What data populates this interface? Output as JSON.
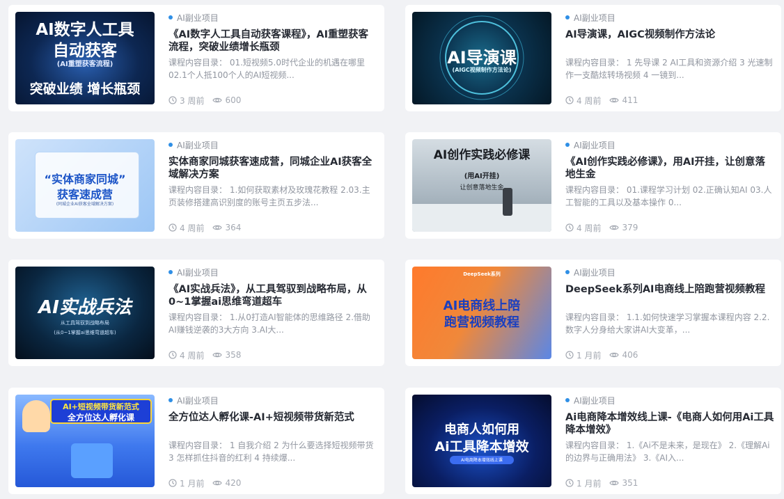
{
  "category_label": "AI副业项目",
  "cards": [
    {
      "title": "《AI数字人工具自动获客课程》，AI重塑获客流程，突破业绩增长瓶颈",
      "desc": "课程内容目录： 01.短视频5.0时代企业的机遇在哪里 02.1个人抵100个人的AI短视频...",
      "time": "3 周前",
      "views": "600",
      "thumb_lines": [
        "AI数字人工具",
        "自动获客",
        "(AI重塑获客流程)",
        "突破业绩 增长瓶颈"
      ]
    },
    {
      "title": "AI导演课，AIGC视频制作方法论",
      "desc": "课程内容目录： 1 先导课 2 AI工具和资源介绍 3 光速制作一支酷炫转场视频 4 一镜到...",
      "time": "4 周前",
      "views": "411",
      "thumb_lines": [
        "AI导演课",
        "(AIGC视频制作方法论)"
      ]
    },
    {
      "title": "实体商家同城获客速成营，同城企业AI获客全域解决方案",
      "desc": "课程内容目录： 1.如何获取素材及玫瑰花教程 2.03.主页装修搭建高识别度的账号主页五步法...",
      "time": "4 周前",
      "views": "364",
      "thumb_lines": [
        "“实体商家同城”",
        "获客速成营",
        "(同城企业AI获客全域解决方案)"
      ]
    },
    {
      "title": "《AI创作实践必修课》，用AI开挂，让创意落地生金",
      "desc": "课程内容目录： 01.课程学习计划 02.正确认知AI 03.人工智能的工具以及基本操作 0...",
      "time": "4 周前",
      "views": "379",
      "thumb_lines": [
        "AI创作实践必修课",
        "(用AI开挂)",
        "让创意落地生金"
      ]
    },
    {
      "title": "《AI实战兵法》，从工具驾驭到战略布局，从0~1掌握ai思维弯道超车",
      "desc": "课程内容目录： 1.从0打造AI智能体的思维路径 2.借助AI赚钱逆袭的3大方向 3.AI大...",
      "time": "4 周前",
      "views": "358",
      "thumb_lines": [
        "AI实战兵法",
        "从工具驾驭到战略布局",
        "(从0~1掌握ai思维弯道超车)"
      ]
    },
    {
      "title": "DeepSeek系列AI电商线上陪跑营视频教程",
      "desc": " 课程内容目录： 1.1.如何快速学习掌握本课程内容 2.2.数字人分身给大家讲AI大变革，...",
      "time": "1 月前",
      "views": "406",
      "thumb_lines": [
        "DeepSeek系列",
        "AI电商线上陪",
        "跑营视频教程"
      ]
    },
    {
      "title": "全方位达人孵化课-AI+短视频带货新范式",
      "desc": "课程内容目录： 1 自我介绍 2 为什么要选择短视频带货 3 怎样抓住抖音的红利 4 持续爆...",
      "time": "1 月前",
      "views": "420",
      "thumb_lines": [
        "AI+短视频带货新范式",
        "全方位达人孵化课"
      ]
    },
    {
      "title": "Ai电商降本增效线上课-《电商人如何用Ai工具降本增效》",
      "desc": "课程内容目录： 1.《Ai不是未来，是现在》 2.《理解Ai的边界与正确用法》 3.《AI入...",
      "time": "1 月前",
      "views": "351",
      "thumb_lines": [
        "电商人如何用",
        "Ai工具降本增效",
        "Ai电商降本增效线上课"
      ]
    }
  ]
}
